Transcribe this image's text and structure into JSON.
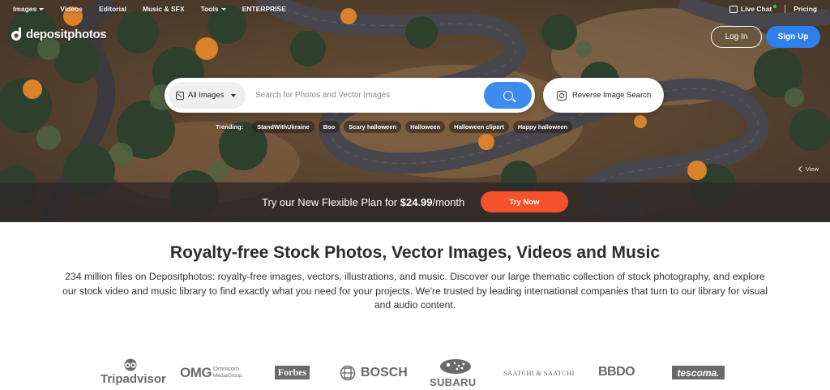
{
  "nav": {
    "left": [
      {
        "label": "Images",
        "dropdown": true
      },
      {
        "label": "Videos",
        "dropdown": false
      },
      {
        "label": "Editorial",
        "dropdown": false
      },
      {
        "label": "Music & SFX",
        "dropdown": false
      },
      {
        "label": "Tools",
        "dropdown": true
      },
      {
        "label": "ENTERPRISE",
        "dropdown": false
      }
    ],
    "live_chat": "Live Chat",
    "pricing": "Pricing"
  },
  "logo": {
    "text": "depositphotos"
  },
  "auth": {
    "login": "Log In",
    "signup": "Sign Up"
  },
  "search": {
    "type_selected": "All Images",
    "placeholder": "Search for Photos and Vector Images",
    "reverse_label": "Reverse Image Search"
  },
  "trending": {
    "label": "Trending:",
    "tags": [
      "StandWithUkraine",
      "Boo",
      "Scary halloween",
      "Halloween",
      "Halloween clipart",
      "Happy halloween"
    ]
  },
  "view_label": "View",
  "promo": {
    "text_before": "Try our New Flexible Plan for ",
    "price": "$24.99",
    "text_after": "/month",
    "button": "Try Now"
  },
  "content": {
    "title": "Royalty-free Stock Photos, Vector Images, Videos and Music",
    "description": "234 million files on Depositphotos: royalty-free images, vectors, illustrations, and music. Discover our large thematic collection of stock photography, and explore our stock video and music library to find exactly what you need for your projects. We're trusted by leading international companies that turn to our library for visual and audio content."
  },
  "brands": [
    "Tripadvisor",
    "OMG",
    "Omnicom",
    "MediaGroup",
    "Forbes",
    "BOSCH",
    "SUBARU",
    "SAATCHI & SAATCHI",
    "BBDO",
    "tescoma."
  ],
  "colors": {
    "signup": "#2f80ed",
    "search_button": "#3d8af0",
    "try_now": "#f4512c",
    "promo_bar": "#2d2828"
  }
}
